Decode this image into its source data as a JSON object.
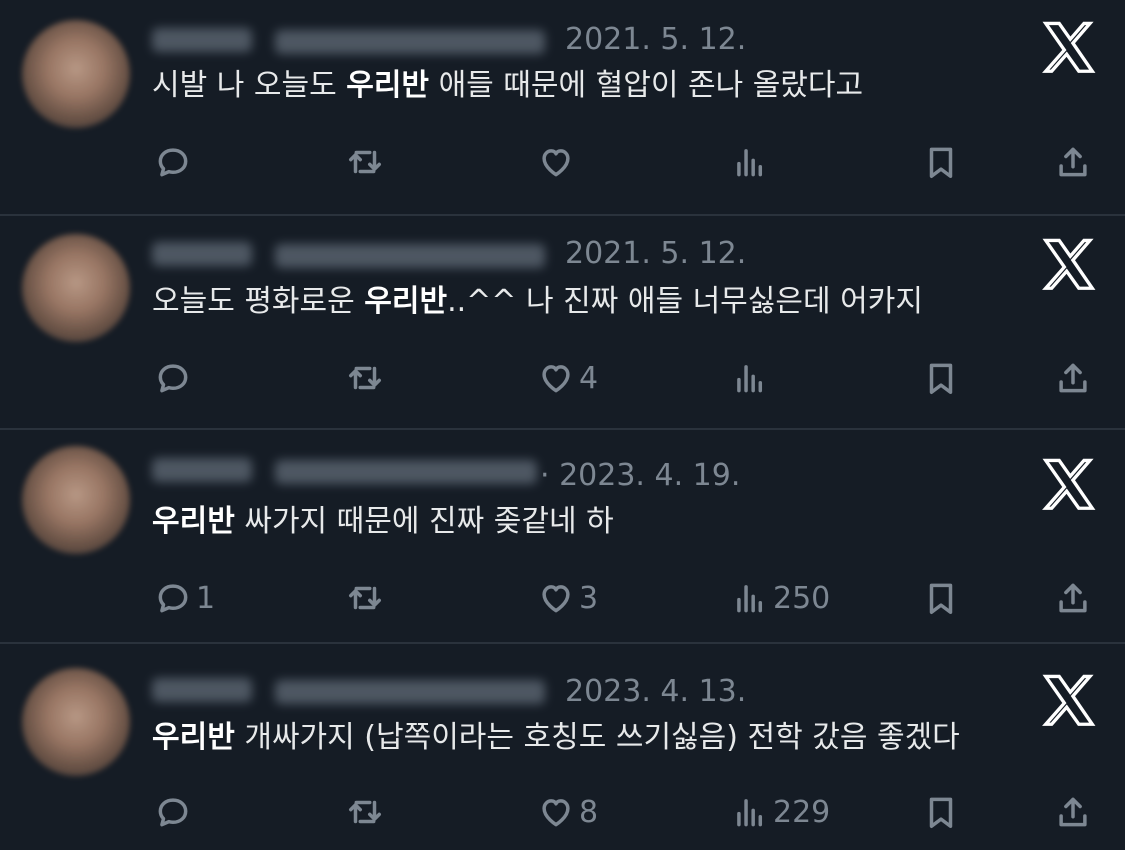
{
  "tweets": [
    {
      "date": "2021. 5. 12.",
      "text_pre": "시발 나 오늘도 ",
      "text_bold": "우리반",
      "text_post": " 애들 때문에 혈압이 존나 올랐다고",
      "replies": "",
      "likes": "",
      "views": ""
    },
    {
      "date": "2021. 5. 12.",
      "text_pre": "오늘도 평화로운 ",
      "text_bold": "우리반",
      "text_post": "..^^ 나 진짜 애들 너무싫은데 어카지",
      "replies": "",
      "likes": "4",
      "views": ""
    },
    {
      "date": "· 2023. 4. 19.",
      "text_pre": "",
      "text_bold": "우리반",
      "text_post": " 싸가지 때문에 진짜 좆같네 하",
      "replies": "1",
      "likes": "3",
      "views": "250"
    },
    {
      "date": "2023. 4. 13.",
      "text_pre": "",
      "text_bold": "우리반",
      "text_post": " 개싸가지 (납쪽이라는 호칭도 쓰기싫음) 전학 갔음 좋겠다",
      "replies": "",
      "likes": "8",
      "views": "229"
    }
  ],
  "colors": {
    "background": "#151c25",
    "text": "#e7e9ea",
    "muted": "#7d8792",
    "divider": "#2a323c"
  },
  "icons": [
    "reply-icon",
    "retweet-icon",
    "like-icon",
    "views-icon",
    "bookmark-icon",
    "share-icon",
    "x-logo-icon"
  ]
}
